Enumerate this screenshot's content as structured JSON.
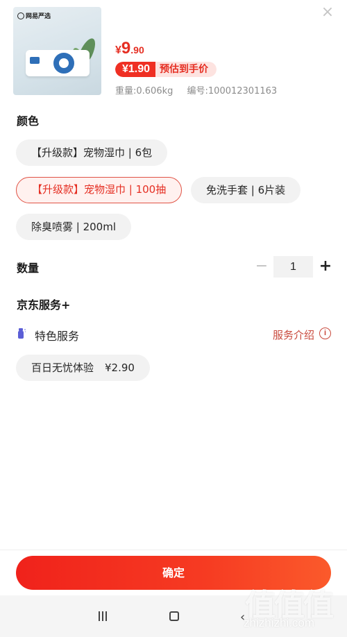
{
  "product": {
    "thumb_brand": "网易严选",
    "price_currency": "¥",
    "price_integer": "9",
    "price_decimal": ".90",
    "estimate_amount": "¥1.90",
    "estimate_label": "预估到手价",
    "weight": "重量:0.606kg",
    "sku": "编号:100012301163"
  },
  "close_icon": "×",
  "color_section": {
    "title": "颜色",
    "options": [
      {
        "label": "【升级款】宠物湿巾 | 6包",
        "selected": false
      },
      {
        "label": "【升级款】宠物湿巾 | 100抽",
        "selected": true
      },
      {
        "label": "免洗手套 | 6片装",
        "selected": false
      },
      {
        "label": "除臭喷雾 | 200ml",
        "selected": false
      }
    ]
  },
  "quantity": {
    "label": "数量",
    "minus": "−",
    "value": "1",
    "plus": "+"
  },
  "jd_service": {
    "title": "京东服务+",
    "special_label": "特色服务",
    "intro_link": "服务介绍",
    "info_icon": "i",
    "option": "百日无忧体验",
    "option_price": "¥2.90"
  },
  "confirm_label": "确定",
  "system_nav": {
    "back_icon": "‹"
  },
  "watermark": {
    "glyphs": "值值值",
    "site": "zhizhizhi.com"
  },
  "colors": {
    "accent": "#e52e22",
    "selected_border": "#e05244",
    "chip_bg": "#f2f2f2"
  },
  "icons": [
    "close-icon",
    "spray-bottle-icon",
    "info-icon",
    "recent-apps-icon",
    "home-icon",
    "back-icon"
  ]
}
